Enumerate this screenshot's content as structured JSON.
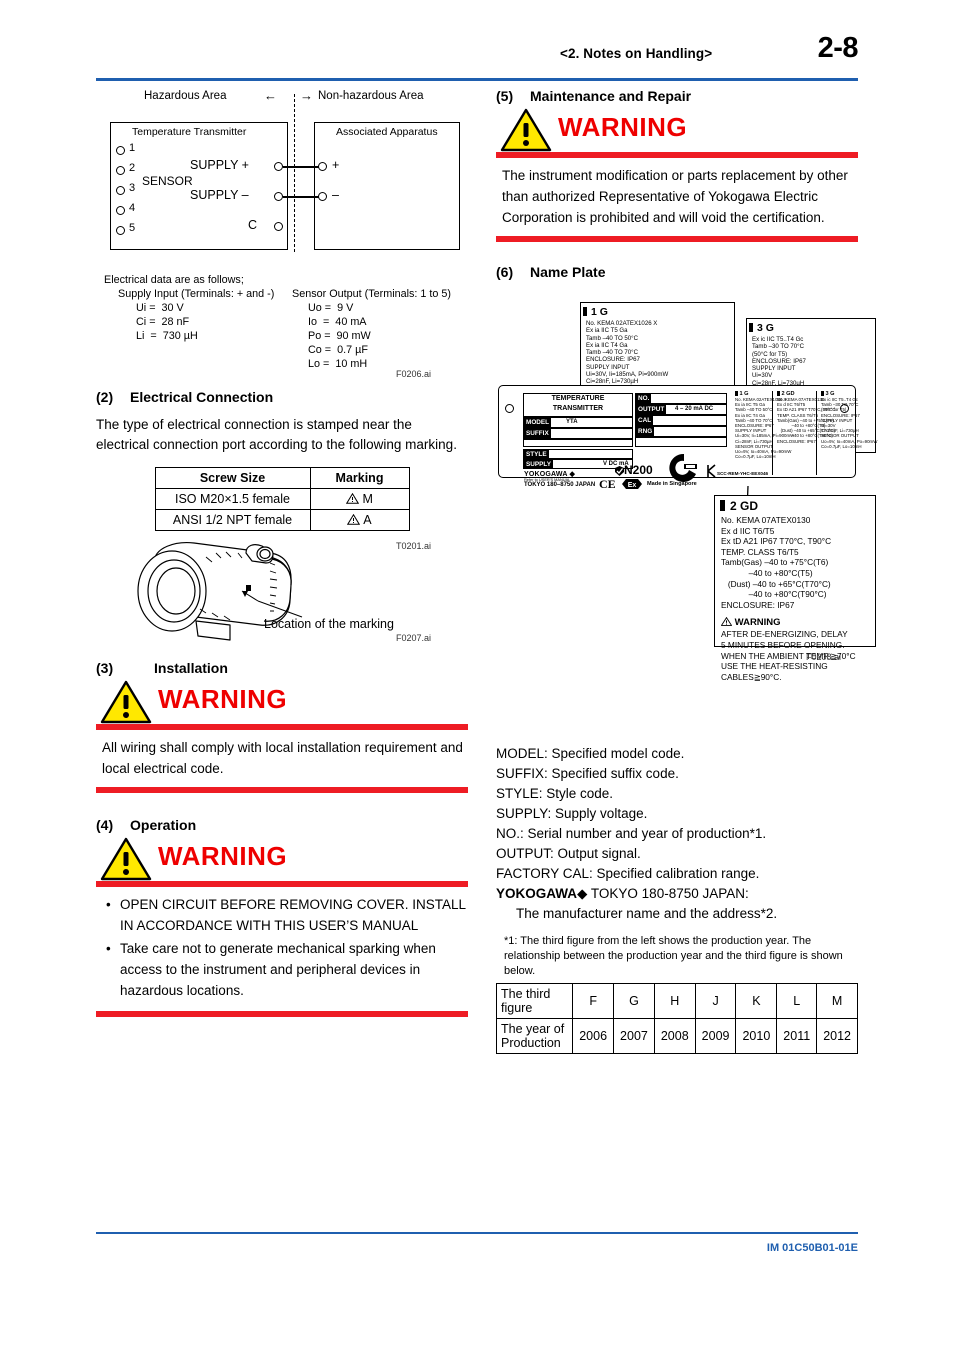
{
  "header": {
    "chapter": "<2.  Notes on Handling>",
    "page_number": "2-8"
  },
  "footer": {
    "doc_code": "IM 01C50B01-01E"
  },
  "left_column": {
    "diagram": {
      "area_hazardous": "Hazardous Area",
      "area_nonhazardous": "Non-hazardous Area",
      "arrow_left": "←",
      "arrow_right": "→",
      "box_transmitter_title": "Temperature Transmitter",
      "box_apparatus_title": "Associated Apparatus",
      "sensor_label": "SENSOR",
      "terminals": [
        "1",
        "2",
        "3",
        "4",
        "5"
      ],
      "supply_plus": "SUPPLY +",
      "supply_minus": "SUPPLY –",
      "terminal_c": "C",
      "apparatus_plus": "+",
      "apparatus_minus": "–",
      "fig_ref": "F0206.ai"
    },
    "electrical_data": {
      "intro": "Electrical data are as follows;",
      "supply_input_title": "Supply Input (Terminals: + and -)",
      "supply_input_values": "Ui =  30 V\nCi =  28 nF\nLi  =  730 µH",
      "sensor_output_title": "Sensor Output (Terminals: 1 to 5)",
      "sensor_output_values": "Uo =  9 V\nIo  =  40 mA\nPo =  90 mW\nCo =  0.7 µF\nLo =  10 mH"
    },
    "section2": {
      "number": "(2)",
      "title": "Electrical Connection",
      "paragraph": "The type of electrical connection is stamped near the electrical connection port according to the following marking.",
      "table": {
        "headers": [
          "Screw Size",
          "Marking"
        ],
        "rows": [
          [
            "ISO M20×1.5 female",
            "M"
          ],
          [
            "ANSI 1/2 NPT female",
            "A"
          ]
        ],
        "fig_ref": "T0201.ai"
      }
    },
    "illustration": {
      "callout": "Location of the marking",
      "fig_ref": "F0207.ai"
    },
    "section3": {
      "number": "(3)",
      "title": "Installation",
      "warning_word": "WARNING",
      "warning_text": "All wiring shall comply with local installation requirement and local electrical code."
    },
    "section4": {
      "number": "(4)",
      "title": "Operation",
      "warning_word": "WARNING",
      "warning_items": [
        "OPEN CIRCUIT BEFORE REMOVING COVER. INSTALL IN ACCORDANCE WITH THIS USER’S MANUAL",
        "Take care not to generate mechanical sparking when access to the instrument and peripheral devices in hazardous locations."
      ]
    }
  },
  "right_column": {
    "section5": {
      "number": "(5)",
      "title": "Maintenance and Repair",
      "warning_word": "WARNING",
      "warning_text": "The instrument modification or parts replacement by other than authorized Representative of Yokogawa Electric Corporation is prohibited and will void the certification."
    },
    "section6": {
      "number": "(6)",
      "title": "Name Plate",
      "fig_ref": "F0208.ai"
    },
    "plate_1g": {
      "title": "1 G",
      "lines": "No. KEMA 02ATEX1026 X\nEx ia IIC T5 Ga\nTamb –40 TO 50°C\nEx ia IIC T4 Ga\nTamb –40 TO 70°C\nENCLOSURE: IP67\nSUPPLY INPUT\nUi=30V, Ii=185mA, Pi=900mW\nCi=28nF, Li=730µH\nSENSOR OUTPUT\nUo=9V, Io=40mA, Po=90mW\nCo=0.7µF, Lo=10mH",
      "warning_head": "WARNING",
      "warning_lines": "POTENTIAL ELECTROSTATIC\nCHARGING HAZARD. SEE\nUSER'S MANUAL BEFORE USE."
    },
    "plate_3g": {
      "title": "3 G",
      "lines": "Ex ic IIC T5..T4 Gc\nTamb –30 TO 70°C\n(50°C for T5)\nENCLOSURE: IP67\nSUPPLY INPUT\nUi=30V\nCi=28nF, Li=730µH\nSENSOR OUTPUT\nUo=9V, Io=40mA, Po=90mW\nCo=0.7µF, Lo=10mH",
      "warning_lines": "POTENTIAL ELECTROSTATIC\nCHARGING HAZARD.\nSEE USER'S MANUAL."
    },
    "plate_2gd": {
      "title": "2 GD",
      "lines": "No. KEMA 07ATEX0130\nEx d IIC T6/T5\nEx tD A21 IP67 T70°C, T90°C\nTEMP. CLASS T6/T5\nTamb(Gas) –40 to +75°C(T6)\n            –40 to +80°C(T5)\n   (Dust) –40 to +65°C(T70°C)\n            –40 to +80°C(T90°C)\nENCLOSURE: IP67",
      "warning_head": "WARNING",
      "warning_lines": "AFTER DE-ENERGIZING, DELAY\n5 MINUTES BEFORE OPENING.\nWHEN THE AMBIENT TEMP.≧70°C\nUSE THE HEAT-RESISTING\nCABLES≧90°C."
    },
    "main_plate": {
      "device_title_line1": "TEMPERATURE",
      "device_title_line2": "TRANSMITTER",
      "label_model": "MODEL",
      "value_model": "YTA",
      "label_suffix": "SUFFIX",
      "label_style": "STYLE",
      "label_supply": "SUPPLY",
      "value_supply": "V DC      mA",
      "label_no": "NO.",
      "label_output": "OUTPUT",
      "value_output": "4  –  20  mA  DC",
      "label_cal": "CAL",
      "label_rng": "RNG",
      "brand": "YOKOGAWA",
      "brand_mark": "◆",
      "refer_line": "Refer to USER'S MANUAL",
      "address": "TOKYO 180–8750 JAPAN",
      "made_in": "Made in Singapore",
      "mark_n200": "N200",
      "mark_ce": "CE",
      "mark_ex": "Ex",
      "mark_kc": "KC",
      "kc_code": "SCC-REM-YHC-EEX046"
    },
    "legend": [
      "MODEL: Specified model code.",
      "SUFFIX: Specified suffix code.",
      "STYLE: Style code.",
      "SUPPLY: Supply voltage.",
      "NO.: Serial number and year of production*1.",
      "OUTPUT: Output signal.",
      "FACTORY CAL: Specified calibration range."
    ],
    "legend_brand_line": "YOKOGAWA",
    "legend_brand_mark": "◆",
    "legend_brand_rest": " TOKYO 180-8750 JAPAN:",
    "legend_brand_sub": "The manufacturer name and the address*2.",
    "footnote1": "*1:  The third figure from the left shows the production year. The relationship between the production year and the third figure is shown below.",
    "year_table": {
      "row1_label": "The third figure",
      "row2_label": "The year of Production",
      "figures": [
        "F",
        "G",
        "H",
        "J",
        "K",
        "L",
        "M"
      ],
      "years": [
        "2006",
        "2007",
        "2008",
        "2009",
        "2010",
        "2011",
        "2012"
      ]
    }
  },
  "colors": {
    "header_blue": "#1F5FAF",
    "warning_red": "#EE1C24",
    "warning_yellow": "#FFE800"
  }
}
